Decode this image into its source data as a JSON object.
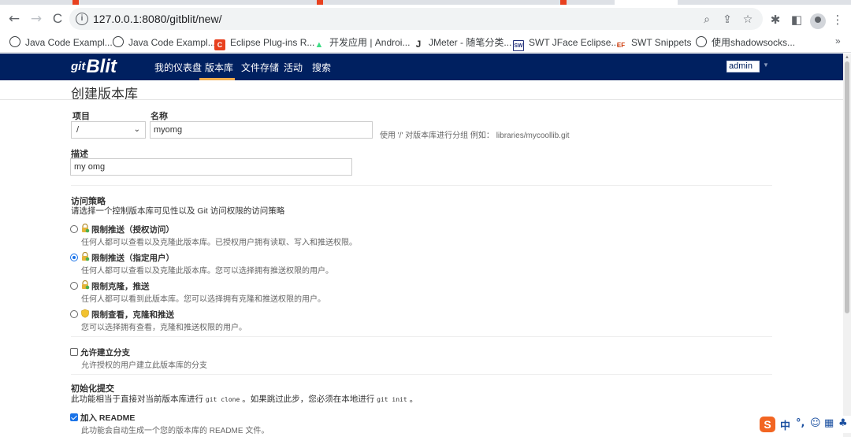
{
  "browser": {
    "url": "127.0.0.1:8080/gitblit/new/",
    "back_glyph": "←",
    "forward_glyph": "→",
    "reload_glyph": "C",
    "info_glyph": "i",
    "bookmarks_more": "»",
    "bookmarks": [
      {
        "label": "Java Code Exampl...",
        "icon": "globe-icon"
      },
      {
        "label": "Java Code Exampl...",
        "icon": "globe-icon"
      },
      {
        "label": "Eclipse Plug-ins R...",
        "icon": "eclipse-icon",
        "badge": "C"
      },
      {
        "label": "开发应用 | Androi...",
        "icon": "android-icon",
        "badge": "▲"
      },
      {
        "label": "JMeter - 随笔分类...",
        "icon": "jmeter-icon",
        "badge": "J"
      },
      {
        "label": "SWT JFace Eclipse...",
        "icon": "swt-icon",
        "badge": "SW"
      },
      {
        "label": "SWT Snippets",
        "icon": "ef-icon",
        "badge": "EF"
      },
      {
        "label": "使用shadowsocks...",
        "icon": "globe-icon"
      }
    ]
  },
  "gitblit": {
    "logo_prefix": "git",
    "logo": "Blit",
    "nav": [
      "我的仪表盘",
      "版本库",
      "文件存储",
      "活动",
      "搜索"
    ],
    "user": "admin"
  },
  "form": {
    "title": "创建版本库",
    "project_label": "项目",
    "project_value": "/",
    "name_label": "名称",
    "name_value": "myomg",
    "name_hint": "使用 '/' 对版本库进行分组 例如： libraries/mycoollib.git",
    "desc_label": "描述",
    "desc_value": "my omg",
    "access_title": "访问策略",
    "access_desc": "请选择一个控制版本库可见性以及 Git 访问权限的访问策略",
    "access_options": [
      {
        "title": "限制推送（授权访问）",
        "desc": "任何人都可以查看以及克隆此版本库。已授权用户拥有读取、写入和推送权限。",
        "checked": false
      },
      {
        "title": "限制推送（指定用户）",
        "desc": "任何人都可以查看以及克隆此版本库。您可以选择拥有推送权限的用户。",
        "checked": true
      },
      {
        "title": "限制克隆，推送",
        "desc": "任何人都可以看到此版本库。您可以选择拥有克隆和推送权限的用户。",
        "checked": false
      },
      {
        "title": "限制查看，克隆和推送",
        "desc": "您可以选择拥有查看，克隆和推送权限的用户。",
        "checked": false
      }
    ],
    "fork_title": "允许建立分支",
    "fork_desc": "允许授权的用户建立此版本库的分支",
    "fork_checked": false,
    "init_title": "初始化提交",
    "init_desc_a": "此功能相当于直接对当前版本库进行 ",
    "init_code_a": "git clone",
    "init_desc_b": " 。如果跳过此步，您必须在本地进行 ",
    "init_code_b": "git init",
    "init_desc_c": " 。",
    "readme_title": "加入 README",
    "readme_desc": "此功能会自动生成一个您的版本库的 README 文件。",
    "readme_checked": true
  },
  "ime": {
    "logo": "S",
    "lang": "中",
    "punct": "°,",
    "emoji": "☺",
    "keyboard": "▦",
    "extra": "♣"
  },
  "colors": {
    "navbar": "#002060",
    "nav_active_underline": "#f0ad4e",
    "accent": "#1a73e8"
  }
}
